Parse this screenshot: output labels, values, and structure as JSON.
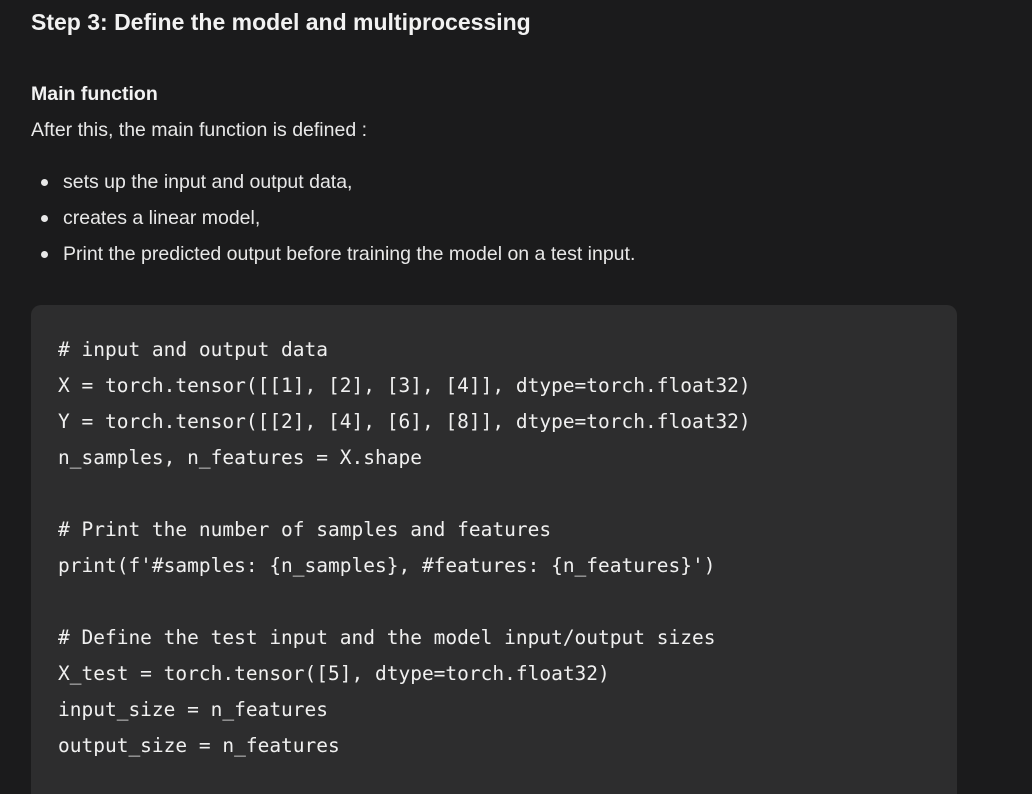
{
  "step_title": "Step 3: Define the model and multiprocessing",
  "section_heading": "Main function",
  "intro": "After this, the main function is defined :",
  "bullets": [
    "sets up the input and output data,",
    "creates a linear model,",
    "Print the predicted output before training the model on a test input."
  ],
  "code": {
    "language": "python",
    "lines": [
      "# input and output data",
      "X = torch.tensor([[1], [2], [3], [4]], dtype=torch.float32)",
      "Y = torch.tensor([[2], [4], [6], [8]], dtype=torch.float32)",
      "n_samples, n_features = X.shape",
      "",
      "# Print the number of samples and features",
      "print(f'#samples: {n_samples}, #features: {n_features}')",
      "",
      "# Define the test input and the model input/output sizes",
      "X_test = torch.tensor([5], dtype=torch.float32)",
      "input_size = n_features",
      "output_size = n_features"
    ]
  }
}
